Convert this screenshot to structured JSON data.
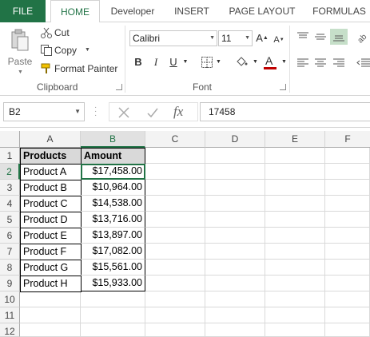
{
  "tabs": [
    "FILE",
    "HOME",
    "Developer",
    "INSERT",
    "PAGE LAYOUT",
    "FORMULAS"
  ],
  "active_tab": "HOME",
  "clipboard": {
    "paste_label": "Paste",
    "cut_label": "Cut",
    "copy_label": "Copy",
    "format_painter_label": "Format Painter",
    "group_label": "Clipboard"
  },
  "font": {
    "font_name": "Calibri",
    "font_size": "11",
    "group_label": "Font",
    "grow_label": "A",
    "shrink_label": "A",
    "bold_label": "B",
    "italic_label": "I",
    "underline_label": "U",
    "font_color_label": "A"
  },
  "formula_bar": {
    "name_box": "B2",
    "fx_label": "fx",
    "value": "17458"
  },
  "columns": [
    "A",
    "B",
    "C",
    "D",
    "E",
    "F"
  ],
  "rows": [
    "1",
    "2",
    "3",
    "4",
    "5",
    "6",
    "7",
    "8",
    "9",
    "10",
    "11",
    "12"
  ],
  "table": {
    "headers": [
      "Products",
      "Amount"
    ],
    "data": [
      [
        "Product A",
        "$17,458.00"
      ],
      [
        "Product B",
        "$10,964.00"
      ],
      [
        "Product C",
        "$14,538.00"
      ],
      [
        "Product D",
        "$13,716.00"
      ],
      [
        "Product E",
        "$13,897.00"
      ],
      [
        "Product F",
        "$17,082.00"
      ],
      [
        "Product G",
        "$15,561.00"
      ],
      [
        "Product H",
        "$15,933.00"
      ]
    ]
  },
  "colors": {
    "accent": "#217346",
    "font_color_bar": "#c00000",
    "header_fill": "#d9d9d9"
  }
}
